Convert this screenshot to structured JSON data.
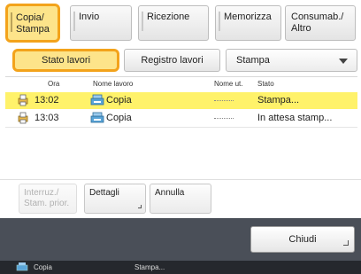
{
  "tabs": [
    {
      "label": "Copia/\nStampa",
      "active": true
    },
    {
      "label": "Invio",
      "active": false
    },
    {
      "label": "Ricezione",
      "active": false
    },
    {
      "label": "Memorizza",
      "active": false
    },
    {
      "label": "Consumab./\nAltro",
      "active": false
    }
  ],
  "subnav": {
    "job_status": "Stato lavori",
    "job_log": "Registro lavori",
    "select_value": "Stampa"
  },
  "list": {
    "headers": {
      "time": "Ora",
      "job_name": "Nome lavoro",
      "user": "Nome ut.",
      "status": "Stato"
    },
    "rows": [
      {
        "time": "13:02",
        "job_name": "Copia",
        "status": "Stampa...",
        "selected": true
      },
      {
        "time": "13:03",
        "job_name": "Copia",
        "status": "In attesa stamp...",
        "selected": false
      }
    ]
  },
  "actions": {
    "interrupt": "Interruz./\nStam. prior.",
    "details": "Dettagli",
    "cancel": "Annulla"
  },
  "footer": {
    "close": "Chiudi"
  },
  "statusbar": {
    "label_a": "Copia",
    "label_b": "Stampa..."
  },
  "colors": {
    "active_fill": "#fde48a",
    "active_border": "#f3a31b",
    "selected_row": "#fff26a",
    "bottom_bar": "#4a4f58",
    "status_bar": "#25282d"
  }
}
